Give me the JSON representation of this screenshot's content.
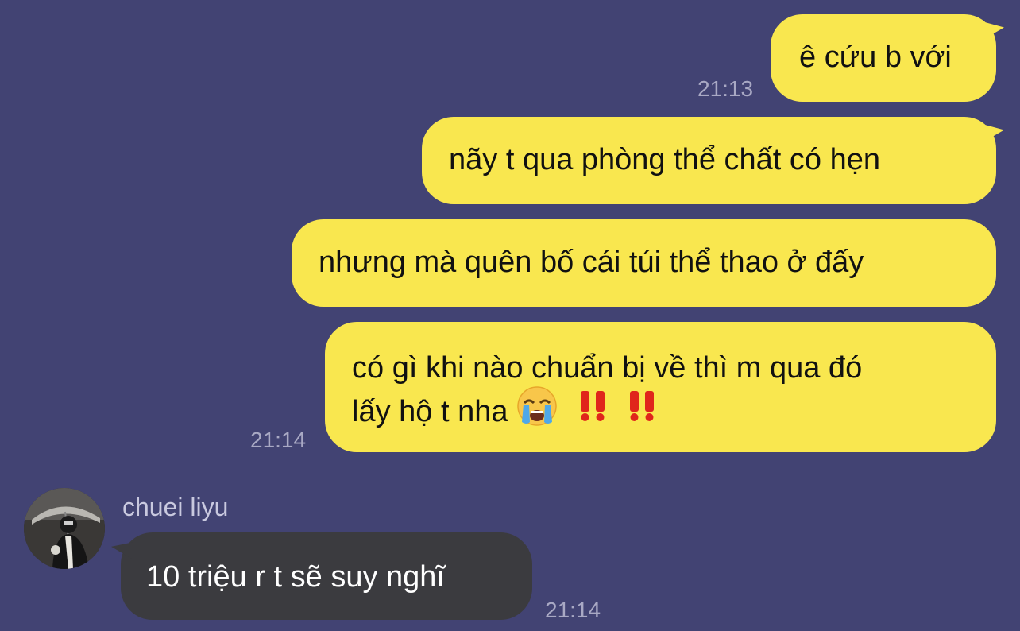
{
  "messages": {
    "m1": {
      "text": "ê cứu b với",
      "time": "21:13"
    },
    "m2": {
      "text": "nãy t qua phòng thể chất có hẹn"
    },
    "m3": {
      "text": "nhưng mà quên bố cái túi thể thao ở đấy"
    },
    "m4": {
      "line1": "có gì khi nào chuẩn bị về thì m qua đó",
      "line2": "lấy hộ t nha",
      "time": "21:14",
      "emoji": "loudly-crying-face-icon",
      "marks": "double-exclamation-icon"
    },
    "m5": {
      "sender": "chuei liyu",
      "text": "10 triệu r t sẽ suy nghĩ",
      "time": "21:14"
    }
  },
  "colors": {
    "background": "#424373",
    "outgoing_bubble": "#f9e74f",
    "incoming_bubble": "#3b3b3f",
    "timestamp": "#a9a9c4"
  }
}
